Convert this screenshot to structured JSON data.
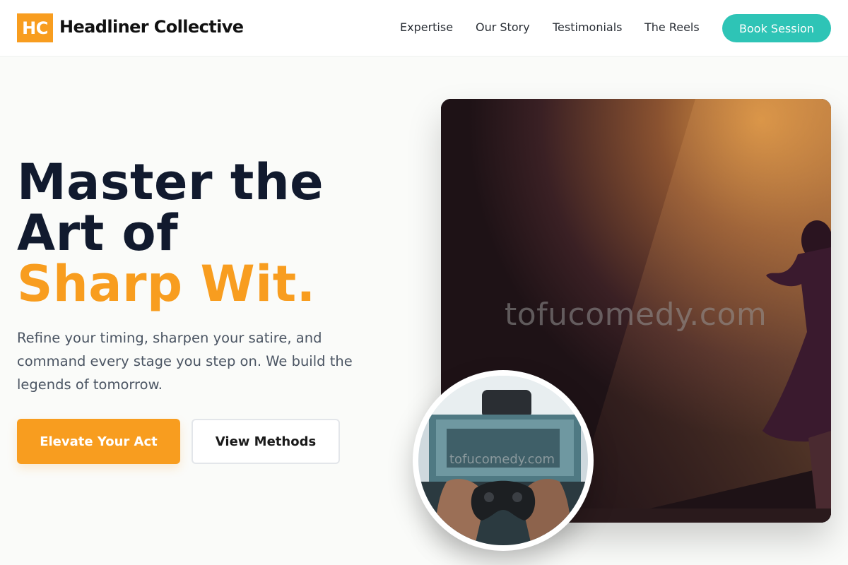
{
  "header": {
    "logo_mark": "HC",
    "brand_name": "Headliner Collective",
    "nav": [
      {
        "label": "Expertise"
      },
      {
        "label": "Our Story"
      },
      {
        "label": "Testimonials"
      },
      {
        "label": "The Reels"
      }
    ],
    "cta_label": "Book Session"
  },
  "hero": {
    "headline_line1": "Master the",
    "headline_line2": "Art of",
    "headline_accent": "Sharp Wit.",
    "lede": "Refine your timing, sharpen your satire, and command every stage you step on. We build the legends of tomorrow.",
    "primary_button": "Elevate Your Act",
    "secondary_button": "View Methods"
  },
  "media": {
    "main_image_watermark": "tofucomedy.com",
    "circle_image_watermark": "tofucomedy.com"
  },
  "colors": {
    "accent_orange": "#f89d1f",
    "accent_teal": "#2ec4b6",
    "heading_navy": "#111a2e",
    "body_gray": "#4b5563"
  }
}
